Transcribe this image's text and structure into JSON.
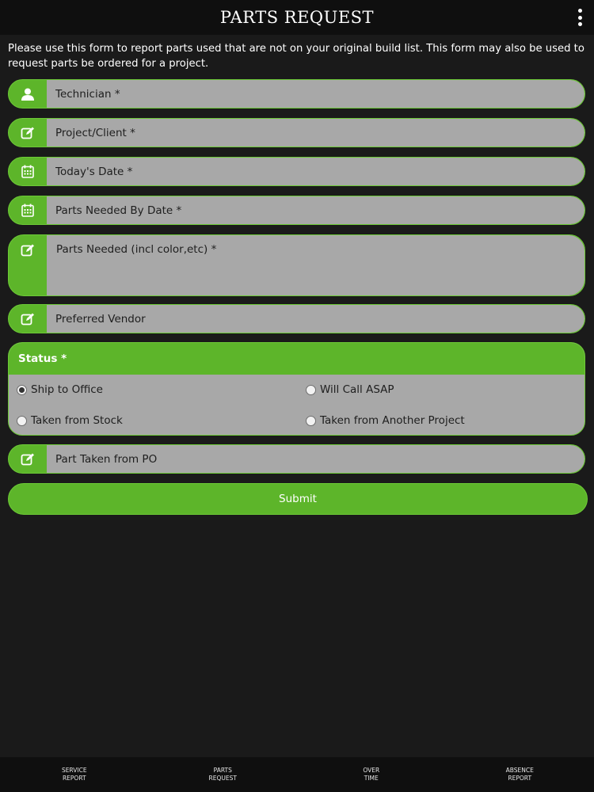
{
  "header": {
    "title": "PARTS REQUEST",
    "menu_icon": "kebab-menu-icon"
  },
  "intro_text": "Please use this form to report parts used that are not on your original build list. This form may also be used to request parts be ordered for a project.",
  "fields": {
    "technician": {
      "placeholder": "Technician *",
      "icon": "user-icon"
    },
    "project_client": {
      "placeholder": "Project/Client *",
      "icon": "edit-icon"
    },
    "todays_date": {
      "placeholder": "Today's Date *",
      "icon": "calendar-icon"
    },
    "parts_needed_by_date": {
      "placeholder": "Parts Needed By Date *",
      "icon": "calendar-icon"
    },
    "parts_needed": {
      "placeholder": "Parts Needed (incl color,etc) *",
      "icon": "edit-icon"
    },
    "preferred_vendor": {
      "placeholder": "Preferred Vendor",
      "icon": "edit-icon"
    },
    "part_taken_from_po": {
      "placeholder": "Part Taken from PO",
      "icon": "edit-icon"
    }
  },
  "status": {
    "label": "Status *",
    "options": [
      {
        "label": "Ship to Office",
        "checked": true
      },
      {
        "label": "Will Call ASAP",
        "checked": false
      },
      {
        "label": "Taken from Stock",
        "checked": false
      },
      {
        "label": "Taken from Another Project",
        "checked": false
      }
    ]
  },
  "submit_label": "Submit",
  "bottom_nav": [
    {
      "label": "SERVICE\nREPORT"
    },
    {
      "label": "PARTS\nREQUEST"
    },
    {
      "label": "OVER\nTIME"
    },
    {
      "label": "ABSENCE\nREPORT"
    }
  ],
  "colors": {
    "accent_green": "#5db52a",
    "field_gray": "#a8a8a8",
    "background": "#1a1a1a",
    "bar": "#0f0f0f"
  }
}
